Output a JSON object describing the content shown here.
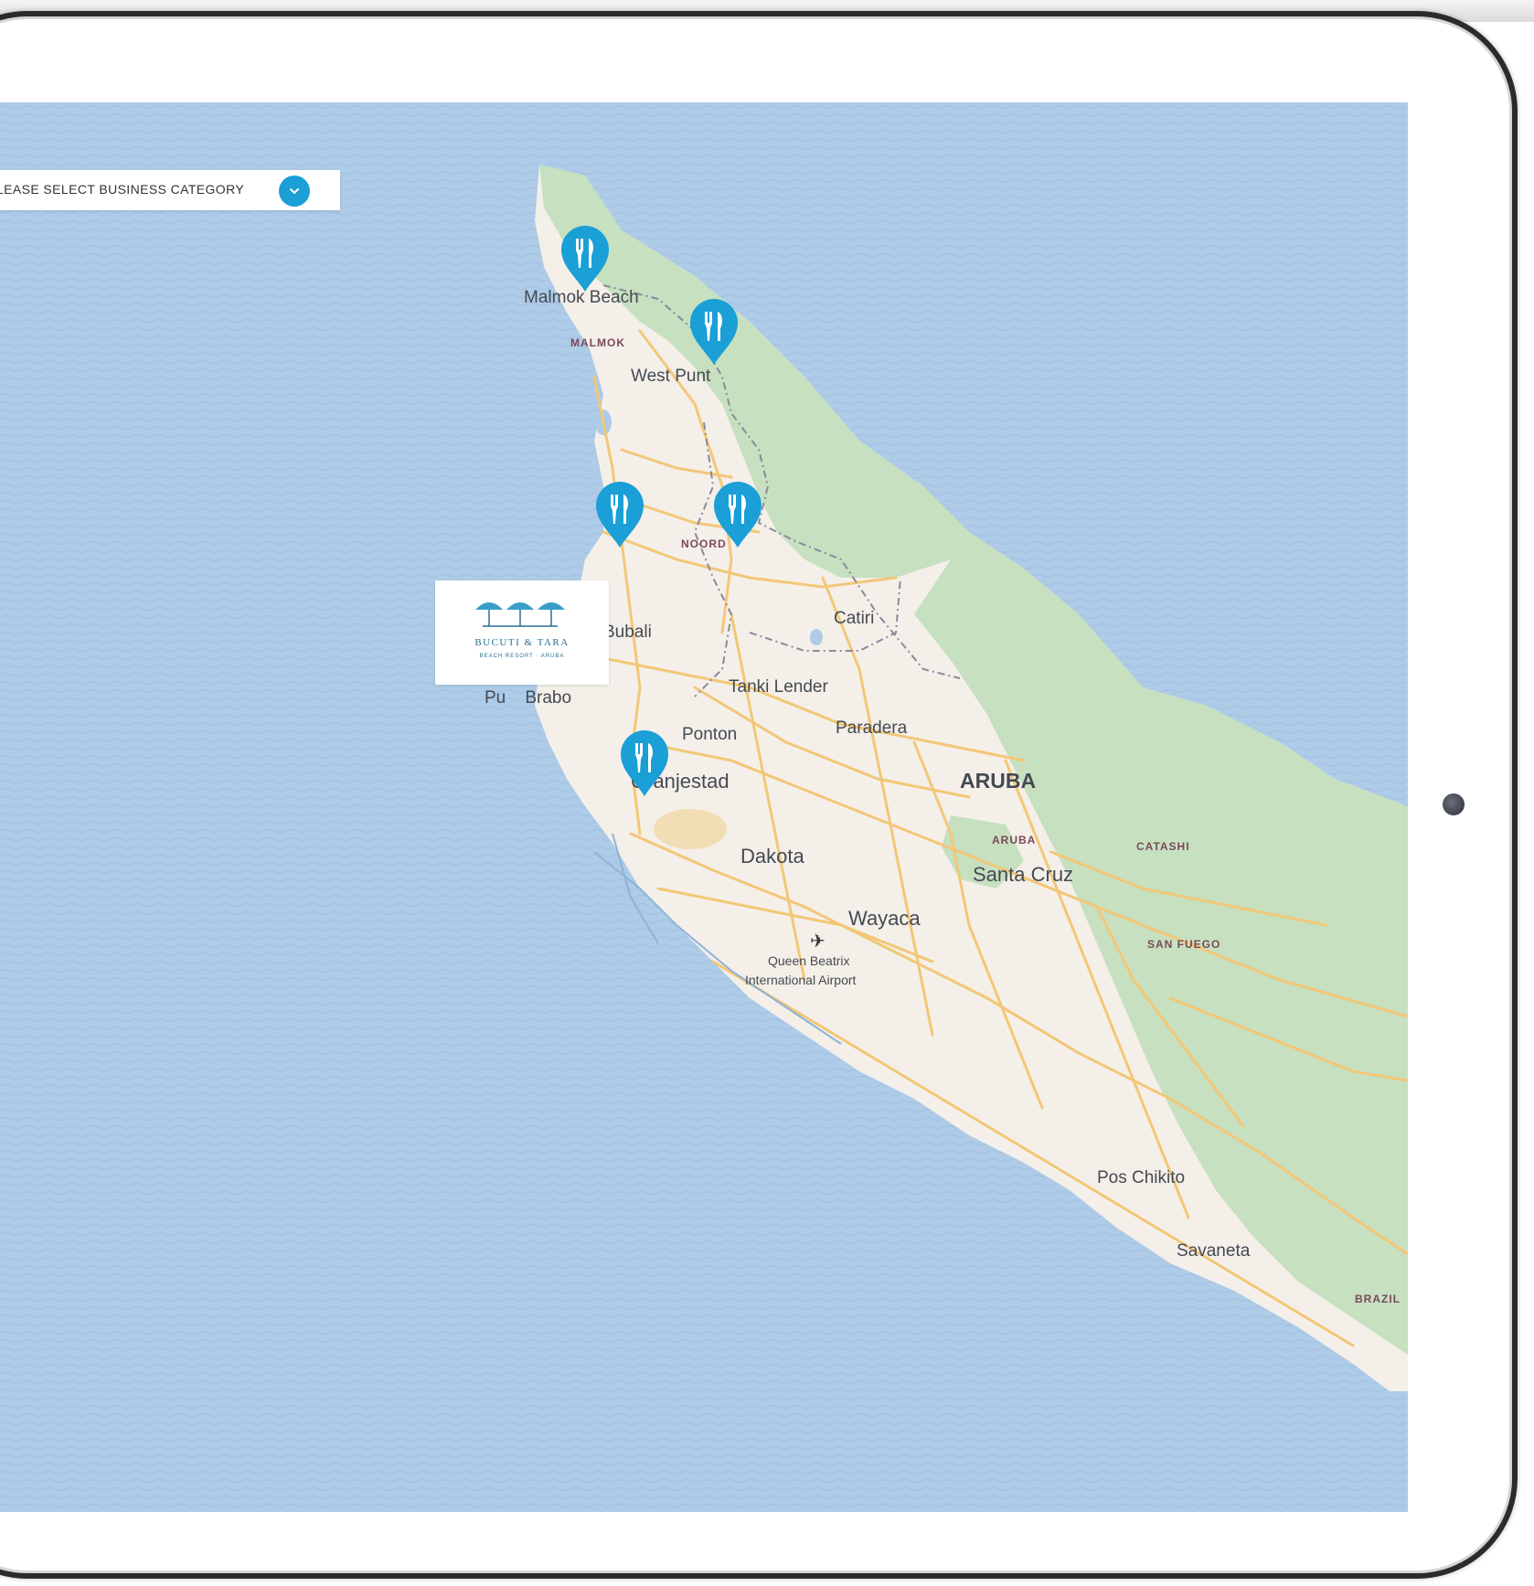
{
  "category_select": {
    "label": "LEASE SELECT BUSINESS CATEGORY",
    "toggle_icon": "chevron-down-icon"
  },
  "resort_logo": {
    "name": "BUCUTI & TARA",
    "tagline": "BEACH RESORT · ARUBA"
  },
  "map": {
    "place_labels": {
      "malmok_beach": "Malmok Beach",
      "malmok": "MALMOK",
      "west_punt": "West Punt",
      "noord": "NOORD",
      "bubali": "Bubali",
      "catiri": "Catiri",
      "tanki_lender": "Tanki Lender",
      "punta_brabo": "Pu    Brabo",
      "ponton": "Ponton",
      "paradera": "Paradera",
      "oranjestad": "Oranjestad",
      "aruba": "ARUBA",
      "aruba_small": "ARUBA",
      "catashi": "CATASHI",
      "dakota": "Dakota",
      "santa_cruz": "Santa Cruz",
      "wayaca": "Wayaca",
      "airport_line1": "Queen Beatrix",
      "airport_line2": "International Airport",
      "san_fuego": "SAN FUEGO",
      "pos_chikito": "Pos Chikito",
      "savaneta": "Savaneta",
      "brazil": "BRAZIL"
    },
    "markers": [
      {
        "name": "restaurant-marker-malmok",
        "icon": "fork-knife-icon"
      },
      {
        "name": "restaurant-marker-west-punt",
        "icon": "fork-knife-icon"
      },
      {
        "name": "restaurant-marker-palm-beach",
        "icon": "fork-knife-icon"
      },
      {
        "name": "restaurant-marker-noord",
        "icon": "fork-knife-icon"
      },
      {
        "name": "restaurant-marker-oranjestad",
        "icon": "fork-knife-icon"
      }
    ],
    "colors": {
      "water": "#aecbe8",
      "land": "#f4efe9",
      "park": "#c7e0c0",
      "road": "#f3c777",
      "marker": "#1a9fd6"
    }
  }
}
